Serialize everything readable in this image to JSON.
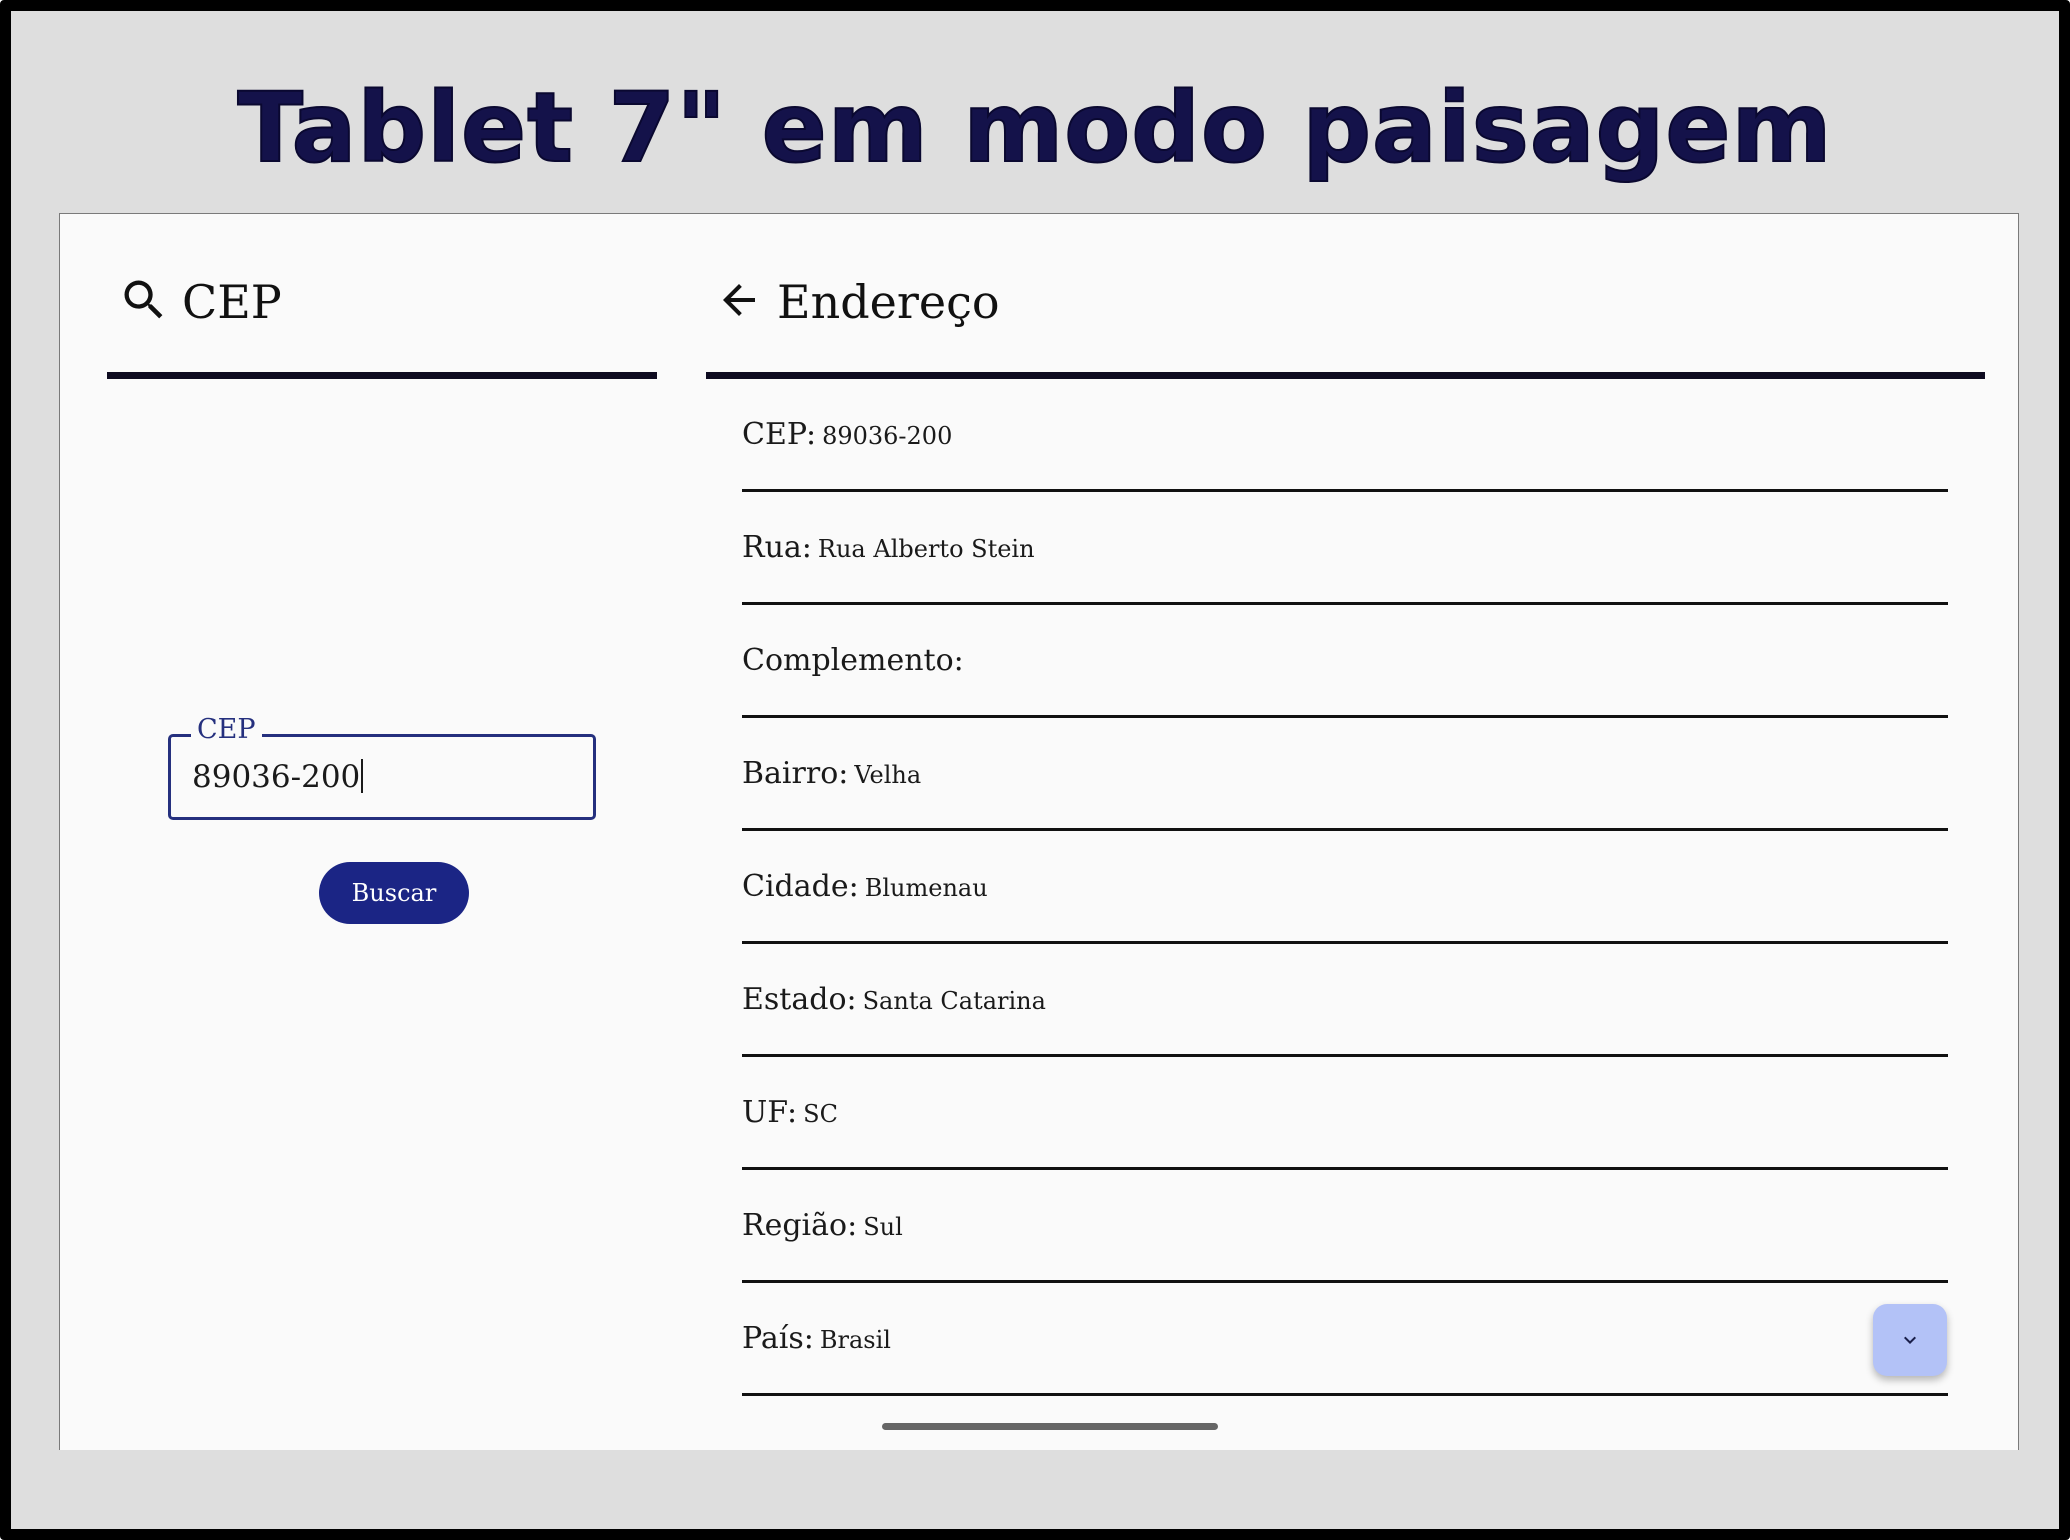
{
  "headline": "Tablet 7\" em modo paisagem",
  "search_panel": {
    "title": "CEP",
    "icon": "search-icon",
    "input": {
      "label": "CEP",
      "value": "89036-200"
    },
    "search_button": "Buscar"
  },
  "address_panel": {
    "title": "Endereço",
    "icon": "arrow-left-icon",
    "fields": [
      {
        "label": "CEP:",
        "value": "89036-200"
      },
      {
        "label": "Rua:",
        "value": "Rua Alberto Stein"
      },
      {
        "label": "Complemento:",
        "value": ""
      },
      {
        "label": "Bairro:",
        "value": "Velha"
      },
      {
        "label": "Cidade:",
        "value": "Blumenau"
      },
      {
        "label": "Estado:",
        "value": "Santa Catarina"
      },
      {
        "label": "UF:",
        "value": "SC"
      },
      {
        "label": "Região:",
        "value": "Sul"
      },
      {
        "label": "País:",
        "value": "Brasil"
      }
    ],
    "scroll_button_icon": "chevron-down-icon"
  },
  "colors": {
    "headline": "#14124a",
    "primary": "#1b2585",
    "fab": "#b3c2f7",
    "divider": "#0e0b20",
    "frame_background": "#dedede",
    "screen_background": "#fafafa"
  }
}
